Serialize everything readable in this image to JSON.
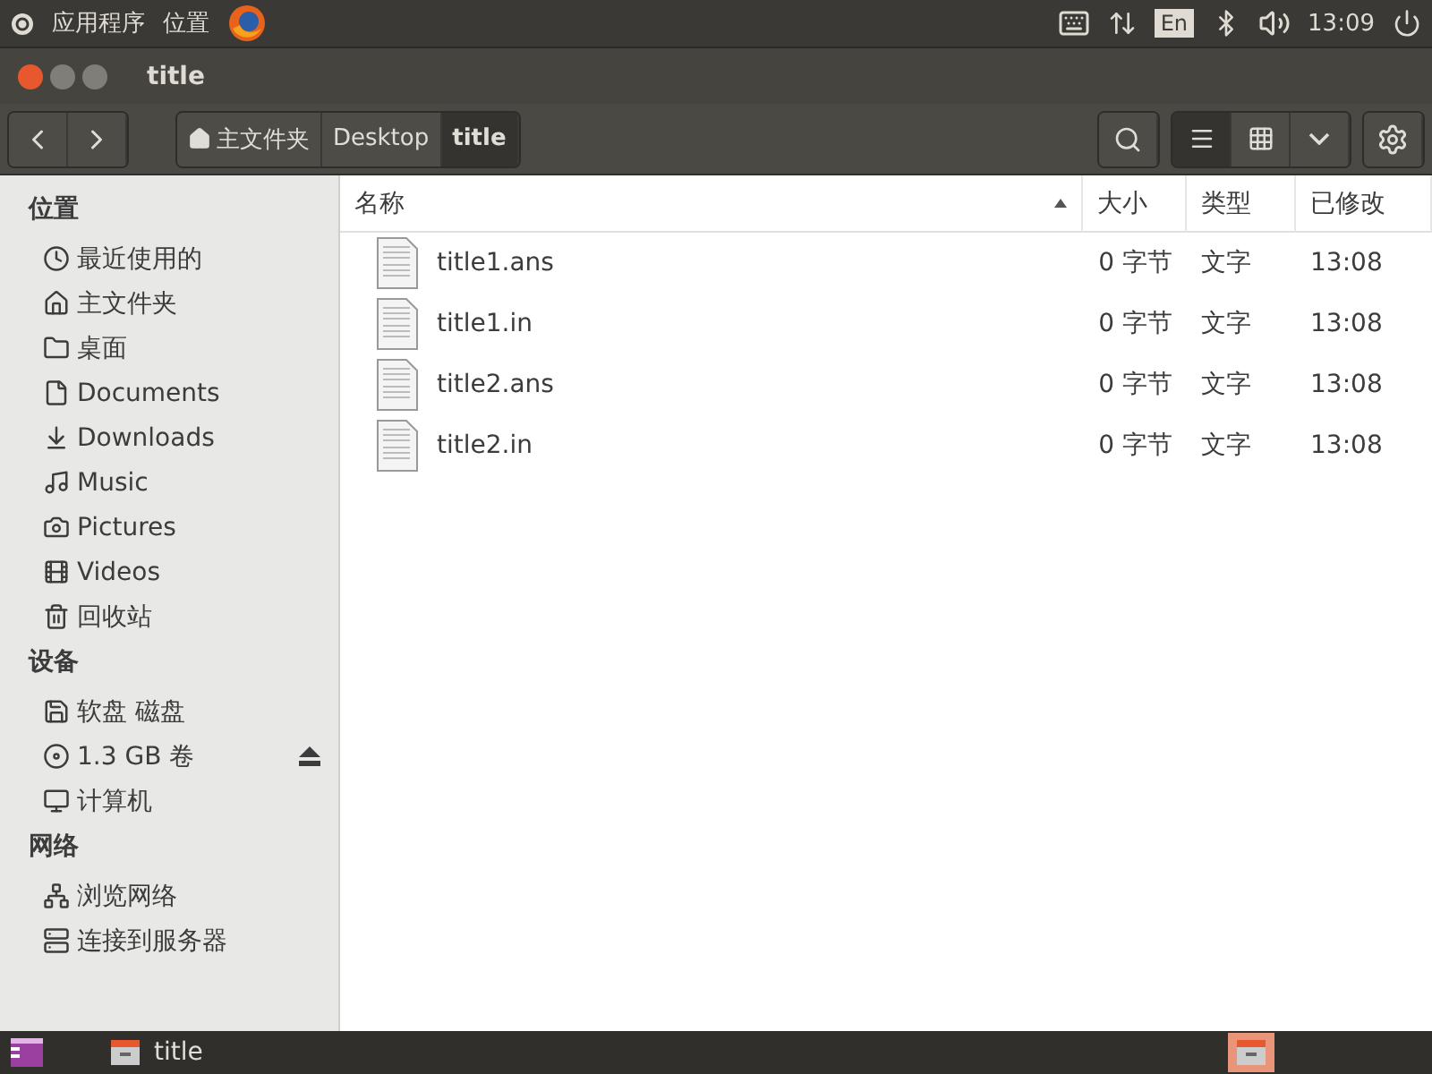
{
  "top_panel": {
    "menus": [
      "应用程序",
      "位置"
    ],
    "language": "En",
    "clock": "13:09"
  },
  "window": {
    "title": "title"
  },
  "breadcrumb": [
    {
      "label": "主文件夹",
      "kind": "home",
      "selected": false
    },
    {
      "label": "Desktop",
      "kind": "folder",
      "selected": false
    },
    {
      "label": "title",
      "kind": "folder",
      "selected": true
    }
  ],
  "view_buttons": [
    {
      "kind": "list",
      "selected": true
    },
    {
      "kind": "grid",
      "selected": false
    }
  ],
  "sidebar": [
    {
      "heading": "位置",
      "items": [
        {
          "label": "最近使用的",
          "kind": "recent"
        },
        {
          "label": "主文件夹",
          "kind": "home"
        },
        {
          "label": "桌面",
          "kind": "desktop"
        },
        {
          "label": "Documents",
          "kind": "documents"
        },
        {
          "label": "Downloads",
          "kind": "downloads"
        },
        {
          "label": "Music",
          "kind": "music"
        },
        {
          "label": "Pictures",
          "kind": "pictures"
        },
        {
          "label": "Videos",
          "kind": "videos"
        },
        {
          "label": "回收站",
          "kind": "trash"
        }
      ]
    },
    {
      "heading": "设备",
      "items": [
        {
          "label": "软盘 磁盘",
          "kind": "floppy"
        },
        {
          "label": "1.3 GB 卷",
          "kind": "disc",
          "ejectable": true
        },
        {
          "label": "计算机",
          "kind": "computer"
        }
      ]
    },
    {
      "heading": "网络",
      "items": [
        {
          "label": "浏览网络",
          "kind": "network"
        },
        {
          "label": "连接到服务器",
          "kind": "server"
        }
      ]
    }
  ],
  "table": {
    "columns": [
      "名称",
      "大小",
      "类型",
      "已修改"
    ],
    "rows": [
      {
        "name": "title1.ans",
        "size": "0 字节",
        "type": "文字",
        "modified": "13:08"
      },
      {
        "name": "title1.in",
        "size": "0 字节",
        "type": "文字",
        "modified": "13:08"
      },
      {
        "name": "title2.ans",
        "size": "0 字节",
        "type": "文字",
        "modified": "13:08"
      },
      {
        "name": "title2.in",
        "size": "0 字节",
        "type": "文字",
        "modified": "13:08"
      }
    ]
  },
  "taskbar": {
    "window": "title"
  }
}
